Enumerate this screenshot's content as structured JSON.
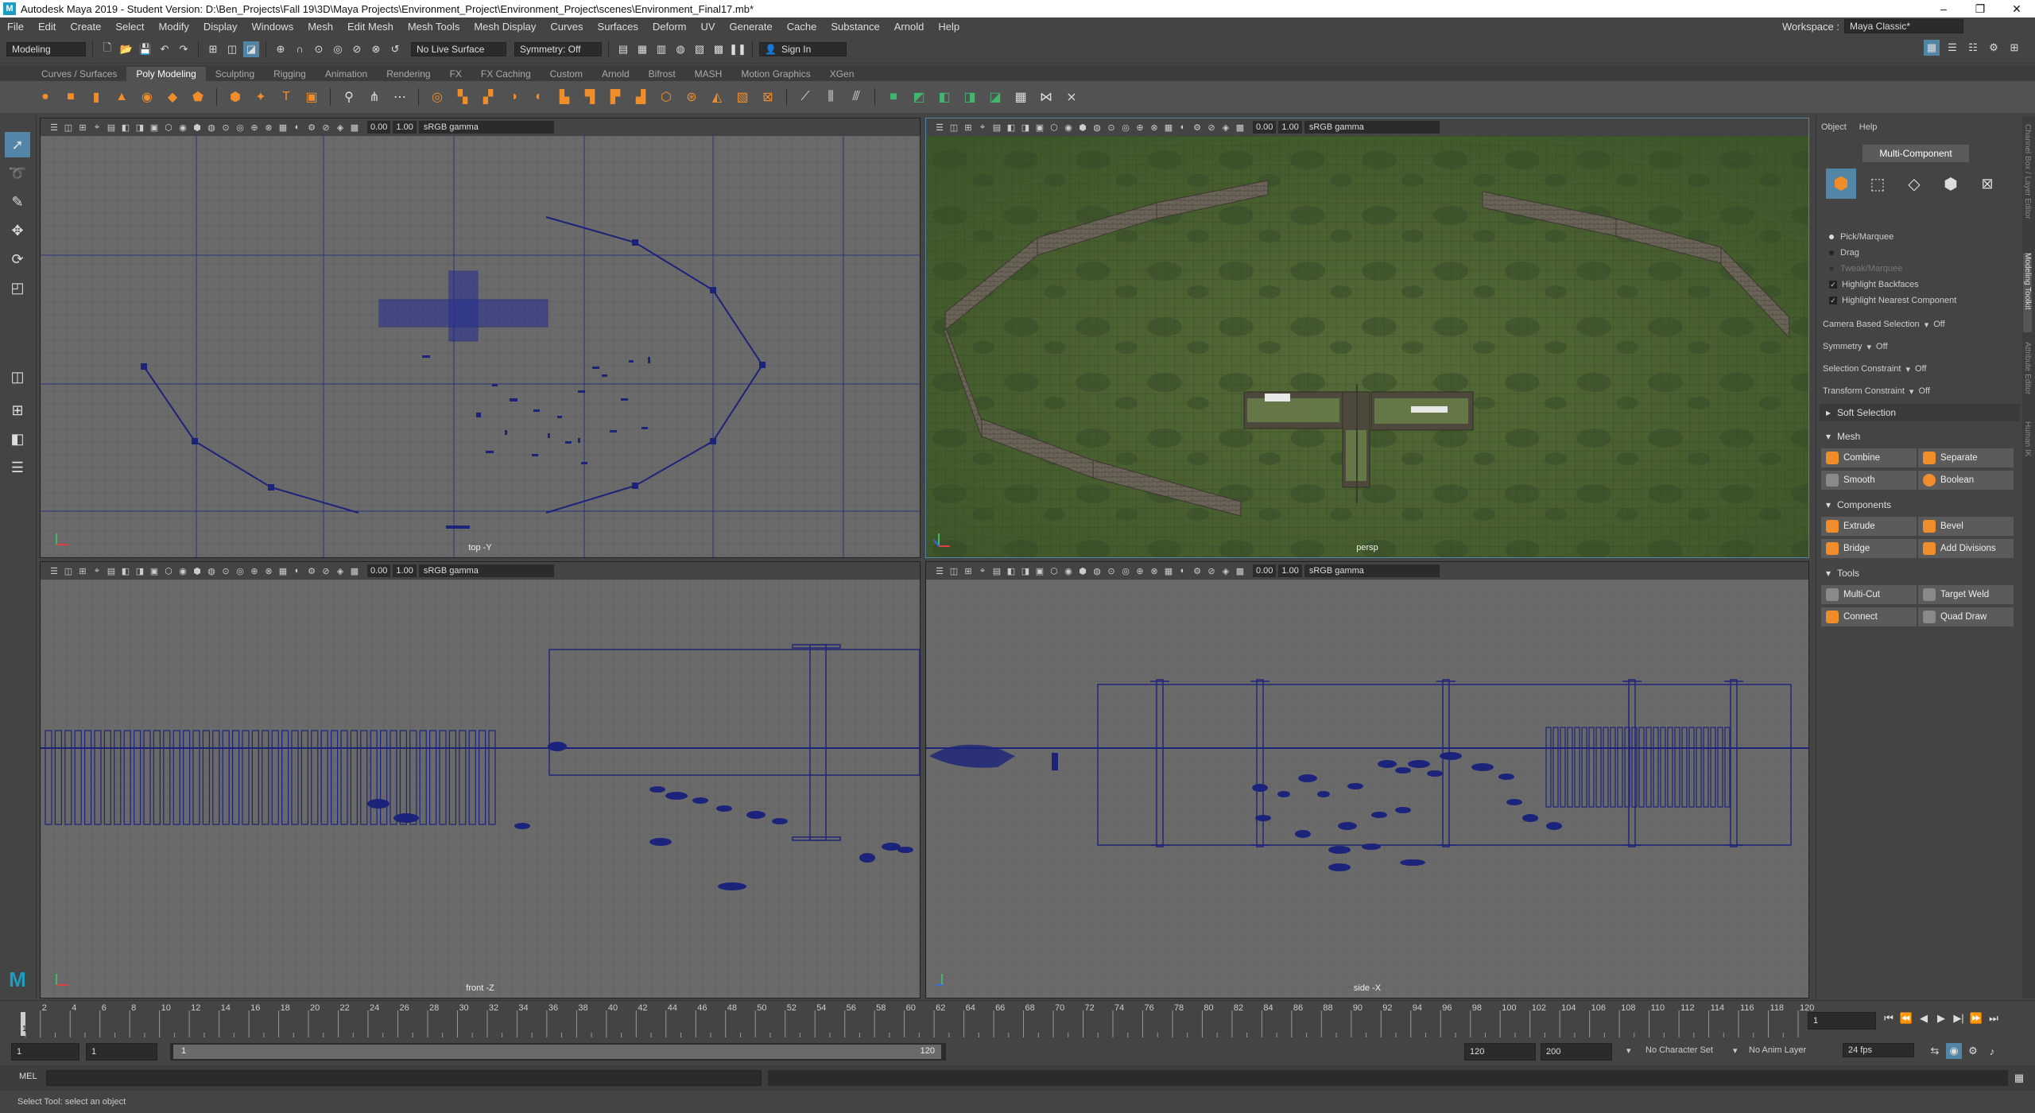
{
  "window": {
    "title": "Autodesk Maya 2019 - Student Version: D:\\Ben_Projects\\Fall 19\\3D\\Maya Projects\\Environment_Project\\Environment_Project\\scenes\\Environment_Final17.mb*",
    "min": "–",
    "max": "❐",
    "close": "✕"
  },
  "menu": [
    "File",
    "Edit",
    "Create",
    "Select",
    "Modify",
    "Display",
    "Windows",
    "Mesh",
    "Edit Mesh",
    "Mesh Tools",
    "Mesh Display",
    "Curves",
    "Surfaces",
    "Deform",
    "UV",
    "Generate",
    "Cache",
    "Substance",
    "Arnold",
    "Help"
  ],
  "workspace": {
    "label": "Workspace :",
    "value": "Maya Classic*"
  },
  "status": {
    "mode": "Modeling",
    "live_surface": "No Live Surface",
    "symmetry": "Symmetry: Off",
    "sign_in": "Sign In"
  },
  "shelf_tabs": [
    "Curves / Surfaces",
    "Poly Modeling",
    "Sculpting",
    "Rigging",
    "Animation",
    "Rendering",
    "FX",
    "FX Caching",
    "Custom",
    "Arnold",
    "Bifrost",
    "MASH",
    "Motion Graphics",
    "XGen"
  ],
  "shelf_active": "Poly Modeling",
  "viewports": {
    "exposure": "0.00",
    "gamma": "1.00",
    "colorspace": "sRGB gamma",
    "top": "top -Y",
    "persp": "persp",
    "front": "front -Z",
    "side": "side -X"
  },
  "modeling_toolkit": {
    "menu_object": "Object",
    "menu_help": "Help",
    "multi_component": "Multi-Component",
    "pick_marquee": "Pick/Marquee",
    "drag": "Drag",
    "tweak_marquee": "Tweak/Marquee",
    "highlight_backfaces": "Highlight Backfaces",
    "highlight_nearest": "Highlight Nearest Component",
    "camera_based_selection": "Camera Based Selection",
    "symmetry": "Symmetry",
    "selection_constraint": "Selection Constraint",
    "transform_constraint": "Transform Constraint",
    "off": "Off",
    "soft_selection": "Soft Selection",
    "mesh": "Mesh",
    "combine": "Combine",
    "separate": "Separate",
    "smooth": "Smooth",
    "boolean": "Boolean",
    "components": "Components",
    "extrude": "Extrude",
    "bevel": "Bevel",
    "bridge": "Bridge",
    "add_divisions": "Add Divisions",
    "tools": "Tools",
    "multi_cut": "Multi-Cut",
    "target_weld": "Target Weld",
    "connect": "Connect",
    "quad_draw": "Quad Draw"
  },
  "side_tabs": [
    "Channel Box / Layer Editor",
    "Modeling Toolkit",
    "Attribute Editor",
    "Human IK"
  ],
  "timeline": {
    "ticks": [
      "2",
      "4",
      "6",
      "8",
      "10",
      "12",
      "14",
      "16",
      "18",
      "20",
      "22",
      "24",
      "26",
      "28",
      "30",
      "32",
      "34",
      "36",
      "38",
      "40",
      "42",
      "44",
      "46",
      "48",
      "50",
      "52",
      "54",
      "56",
      "58",
      "60",
      "62",
      "64",
      "66",
      "68",
      "70",
      "72",
      "74",
      "76",
      "78",
      "80",
      "82",
      "84",
      "86",
      "88",
      "90",
      "92",
      "94",
      "96",
      "98",
      "100",
      "102",
      "104",
      "106",
      "108",
      "110",
      "112",
      "114",
      "116",
      "118",
      "120"
    ],
    "current_frame": "1",
    "current_marker": "1"
  },
  "range": {
    "start": "1",
    "inner_start": "1",
    "handle_start": "1",
    "handle_end": "120",
    "end": "120",
    "outer_end": "200",
    "character_set": "No Character Set",
    "anim_layer": "No Anim Layer",
    "fps": "24 fps"
  },
  "command": {
    "lang": "MEL"
  },
  "help": "Select Tool: select an object",
  "colors": {
    "accent_orange": "#f08c2a",
    "accent_green": "#3fb86e",
    "wire_blue": "#1c237a",
    "selected_blue": "#5285a6"
  }
}
